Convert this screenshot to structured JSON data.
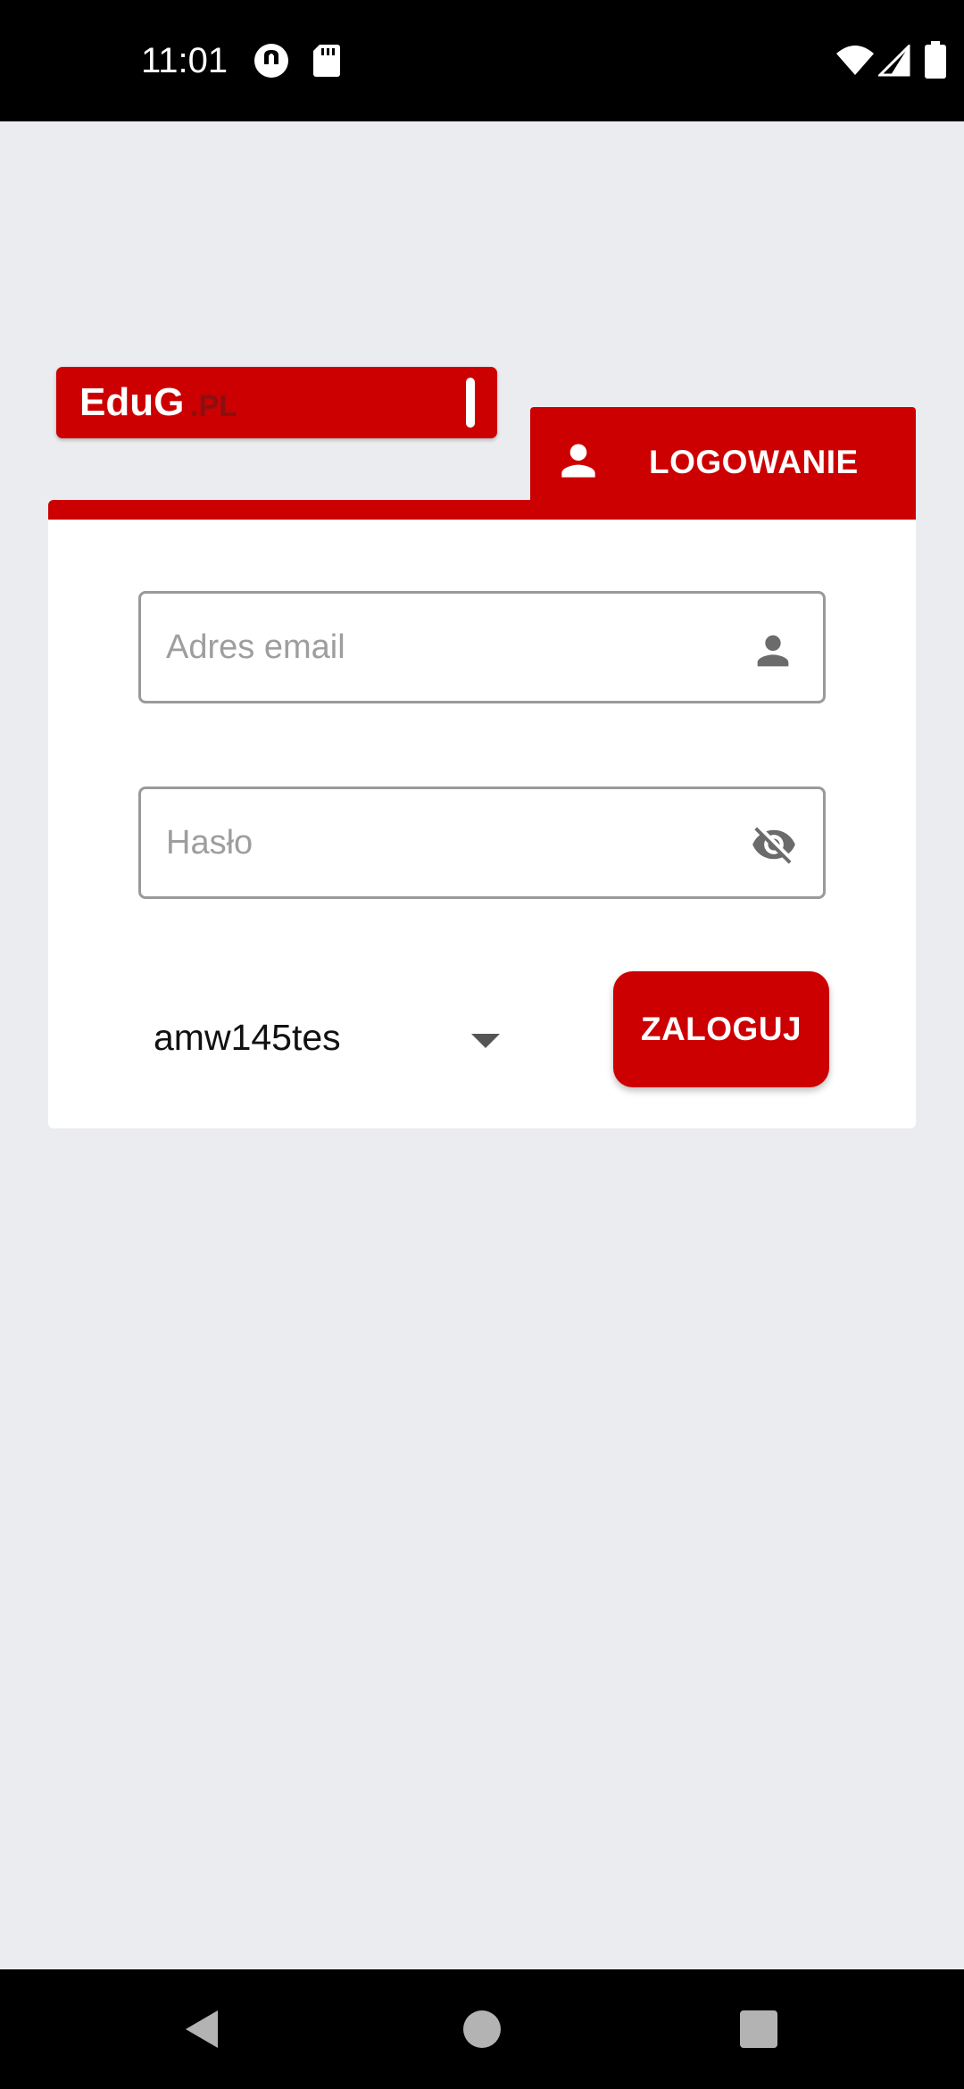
{
  "status_bar": {
    "time": "11:01",
    "icons_left": [
      "headset-circle-icon",
      "sd-card-icon"
    ],
    "icons_right": [
      "wifi-icon",
      "cell-signal-icon",
      "battery-icon"
    ]
  },
  "logo": {
    "main_text": "EduG",
    "suffix_text": ".PL"
  },
  "tab": {
    "label": "LOGOWANIE",
    "icon": "person-icon"
  },
  "form": {
    "email": {
      "placeholder": "Adres email",
      "value": "",
      "icon": "person-icon"
    },
    "password": {
      "placeholder": "Hasło",
      "value": "",
      "icon": "eye-off-icon"
    },
    "domain": {
      "selected": "amw145tes"
    },
    "submit_label": "ZALOGUJ"
  },
  "nav_bar": {
    "icons": [
      "back-icon",
      "home-icon",
      "recents-icon"
    ]
  },
  "colors": {
    "brand_red": "#cc0000",
    "background": "#ebecf0",
    "card": "#ffffff"
  }
}
